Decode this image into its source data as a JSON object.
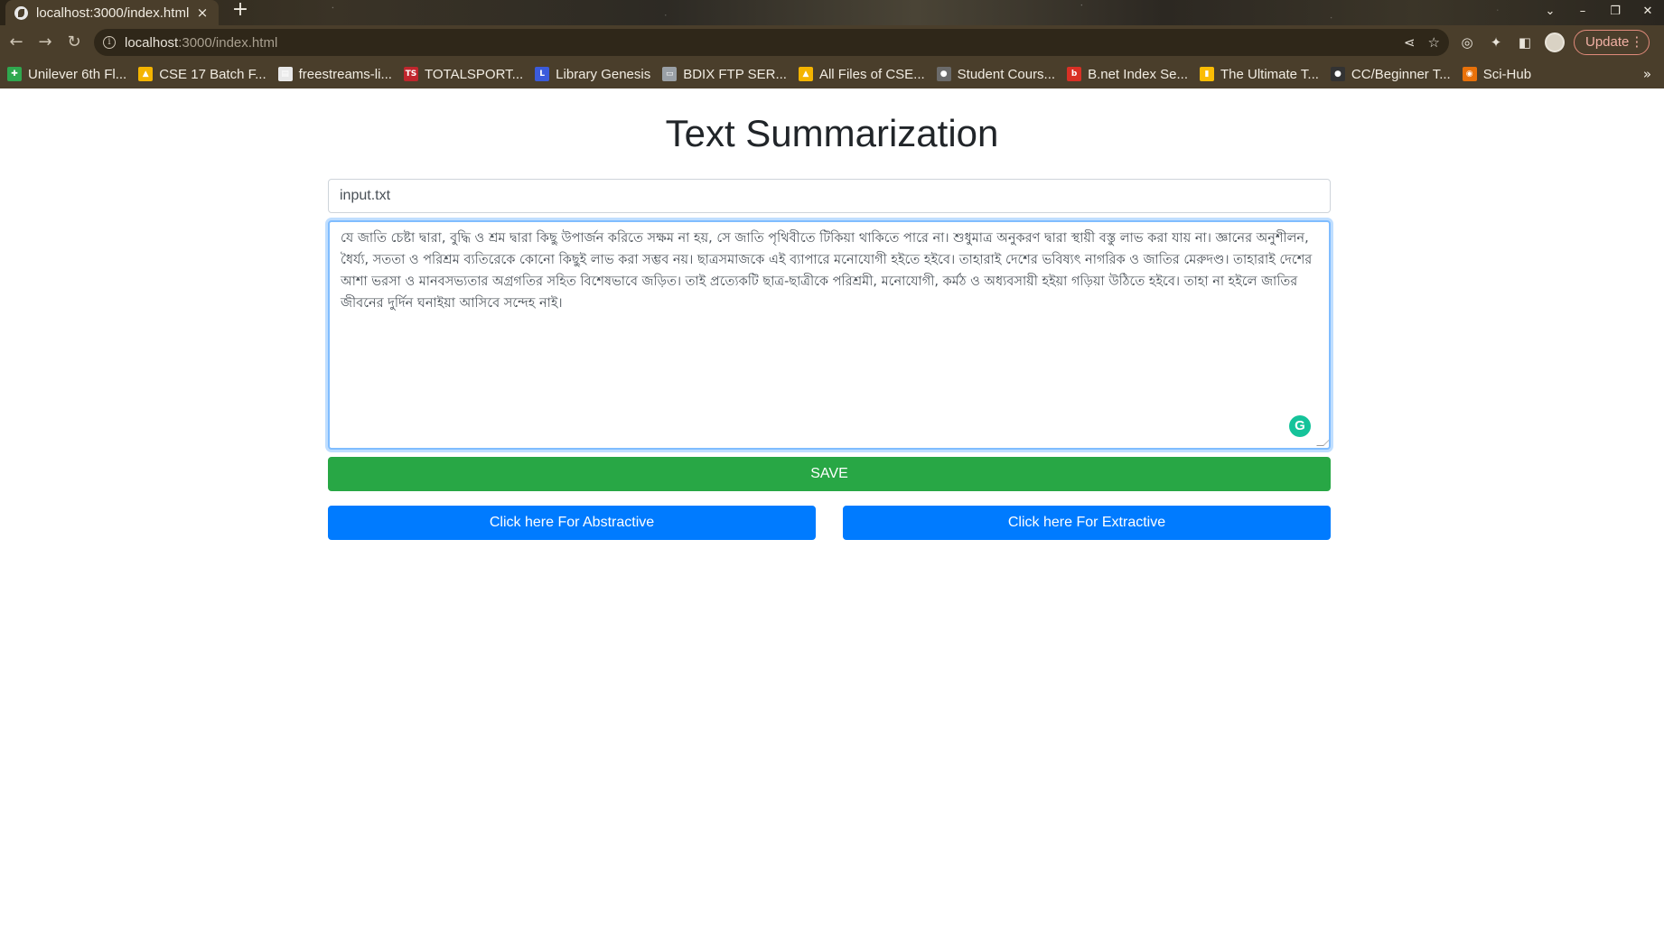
{
  "browser": {
    "tab_title": "localhost:3000/index.html",
    "tab_close": "×",
    "new_tab": "+",
    "url_host": "localhost",
    "url_rest": ":3000/index.html",
    "update_label": "Update",
    "bookmarks": [
      {
        "label": "Unilever 6th Fl...",
        "icon": "green-cross-icon",
        "color": "#2fa84f",
        "glyph": "✚"
      },
      {
        "label": "CSE 17 Batch F...",
        "icon": "google-drive-icon",
        "color": "#f4b400",
        "glyph": "▲"
      },
      {
        "label": "freestreams-li...",
        "icon": "document-icon",
        "color": "#e8e8e8",
        "glyph": "▤"
      },
      {
        "label": "TOTALSPORT...",
        "icon": "totalsport-icon",
        "color": "#c0262d",
        "glyph": "TS"
      },
      {
        "label": "Library Genesis",
        "icon": "library-icon",
        "color": "#3b5bdb",
        "glyph": "L"
      },
      {
        "label": "BDIX FTP SER...",
        "icon": "server-icon",
        "color": "#9aa0a6",
        "glyph": "▭"
      },
      {
        "label": "All Files of CSE...",
        "icon": "google-drive-icon",
        "color": "#f4b400",
        "glyph": "▲"
      },
      {
        "label": "Student Cours...",
        "icon": "globe-icon",
        "color": "#6b6b6b",
        "glyph": "●"
      },
      {
        "label": "B.net Index Se...",
        "icon": "bnet-icon",
        "color": "#d93025",
        "glyph": "b"
      },
      {
        "label": "The Ultimate T...",
        "icon": "bar-chart-icon",
        "color": "#fbbc04",
        "glyph": "▮"
      },
      {
        "label": "CC/Beginner T...",
        "icon": "github-icon",
        "color": "#333333",
        "glyph": "●"
      },
      {
        "label": "Sci-Hub",
        "icon": "scihub-icon",
        "color": "#e8710a",
        "glyph": "◉"
      }
    ],
    "bookmarks_more": "»"
  },
  "page": {
    "title": "Text Summarization",
    "filename_value": "input.txt",
    "text_content": "যে জাতি চেষ্টা দ্বারা, বুদ্ধি ও শ্রম দ্বারা কিছু উপার্জন করিতে সক্ষম না হয়, সে জাতি পৃথিবীতে টিকিয়া থাকিতে পারে না। শুধুমাত্র অনুকরণ দ্বারা স্থায়ী বস্তু লাভ করা যায় না। জ্ঞানের অনুশীলন, ধৈর্য্য, সততা ও পরিশ্রম ব্যতিরেকে কোনো কিছুই লাভ করা সম্ভব নয়। ছাত্রসমাজকে এই ব্যাপারে মনোযোগী হইতে হইবে। তাহারাই দেশের ভবিষ্যৎ নাগরিক ও জাতির মেরুদণ্ড। তাহারাই দেশের আশা ভরসা ও মানবসভ্যতার অগ্রগতির সহিত বিশেষভাবে জড়িত। তাই প্রত্যেকটি ছাত্র-ছাত্রীকে পরিশ্রমী, মনোযোগী, কর্মঠ ও অধ্যবসায়ী হইয়া গড়িয়া উঠিতে হইবে। তাহা না হইলে জাতির জীবনের দুর্দিন ঘনাইয়া আসিবে সন্দেহ নাই।",
    "save_label": "SAVE",
    "abstractive_label": "Click here For Abstractive",
    "extractive_label": "Click here For Extractive"
  },
  "colors": {
    "save_green": "#28a745",
    "primary_blue": "#007bff",
    "chrome_brown": "#4a3e2b"
  }
}
